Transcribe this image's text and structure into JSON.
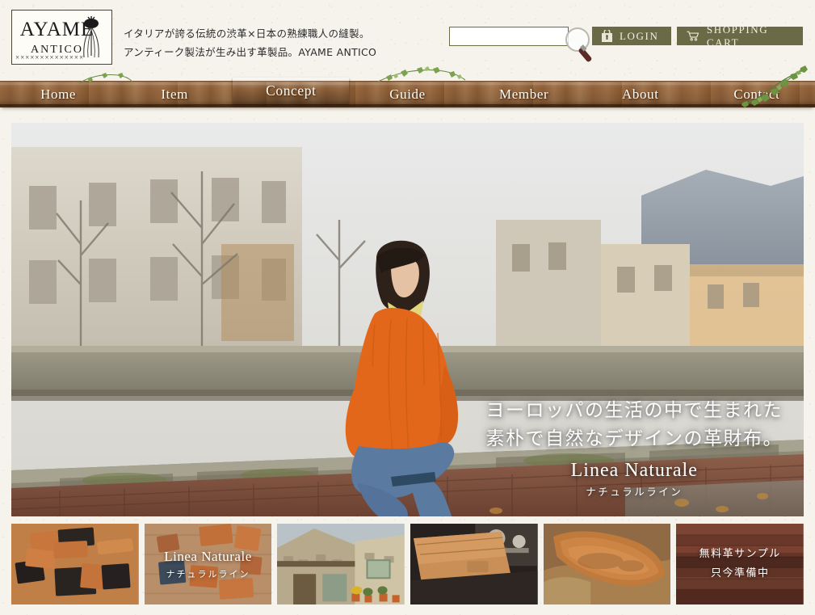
{
  "site": {
    "logo_main": "AYAME",
    "logo_sub": "ANTICO",
    "logo_stitch": "××××××××××××××"
  },
  "header": {
    "tagline_line1": "イタリアが誇る伝統の渋革×日本の熟練職人の縫製。",
    "tagline_line2": "アンティーク製法が生み出す革製品。AYAME ANTICO",
    "search": {
      "value": "",
      "placeholder": ""
    },
    "login_label": "LOGIN",
    "cart_label": "SHOPPING CART",
    "button_color": "#6b6a46"
  },
  "nav": {
    "items": [
      {
        "label": "Home",
        "active": false
      },
      {
        "label": "Item",
        "active": false
      },
      {
        "label": "Concept",
        "active": true
      },
      {
        "label": "Guide",
        "active": false
      },
      {
        "label": "Member",
        "active": false
      },
      {
        "label": "About",
        "active": false
      },
      {
        "label": "Contact",
        "active": false
      }
    ]
  },
  "hero": {
    "line1": "ヨーロッパの生活の中で生まれた",
    "line2": "素朴で自然なデザインの革財布。",
    "brand": "Linea Naturale",
    "brand_jp": "ナチュラルライン"
  },
  "thumbnails": [
    {
      "name": "leather-wallets-on-hide",
      "caption_main": "",
      "caption_sub": "",
      "caption_jp": ""
    },
    {
      "name": "wallets-on-wood",
      "caption_main": "Linea Naturale",
      "caption_sub": "ナチュラルライン",
      "caption_jp": ""
    },
    {
      "name": "italian-stone-house",
      "caption_main": "",
      "caption_sub": "",
      "caption_jp": ""
    },
    {
      "name": "tan-leather-wallet",
      "caption_main": "",
      "caption_sub": "",
      "caption_jp": ""
    },
    {
      "name": "raw-leather-hide",
      "caption_main": "",
      "caption_sub": "",
      "caption_jp": ""
    },
    {
      "name": "free-leather-sample",
      "caption_main": "",
      "caption_sub": "",
      "caption_jp": "無料革サンプル\n只今準備中"
    }
  ],
  "thumbnail_jp_lines": {
    "sample_line1": "無料革サンプル",
    "sample_line2": "只今準備中"
  }
}
